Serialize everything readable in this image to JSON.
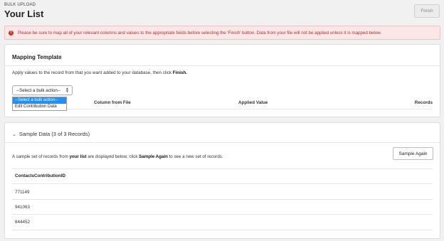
{
  "header": {
    "breadcrumb": "BULK UPLOAD",
    "title": "Your List",
    "finish_label": "Finish"
  },
  "alert": {
    "icon": "exclamation-icon",
    "text": "Please be sure to map all of your relevant columns and values to the appropriate fields before selecting the 'Finish' button. Data from your file will not be applied unless it is mapped below."
  },
  "mapping": {
    "title": "Mapping Template",
    "instruction_prefix": "Apply values to the record from that you want added to your database, then click ",
    "instruction_bold": "Finish.",
    "select_value": "--Select a bulk action--",
    "dropdown_options": [
      "--Select a bulk action--",
      "Edit Contribution Data"
    ],
    "columns": [
      "Column from File",
      "Applied Value",
      "Records"
    ]
  },
  "sample": {
    "toggle_label": "Sample Data (3 of 3 Records)",
    "instr_a": "A sample set of records from ",
    "instr_b": "your list",
    "instr_c": " are displayed below; click ",
    "instr_d": "Sample Again",
    "instr_e": " to see a new set of records.",
    "button_label": "Sample Again",
    "column_header": "ContactsContributionID",
    "rows": [
      "771149",
      "941063",
      "844452"
    ]
  },
  "colors": {
    "alert_text": "#b23131",
    "alert_bg": "#fbe7e7",
    "selected_option": "#1e90ff"
  }
}
